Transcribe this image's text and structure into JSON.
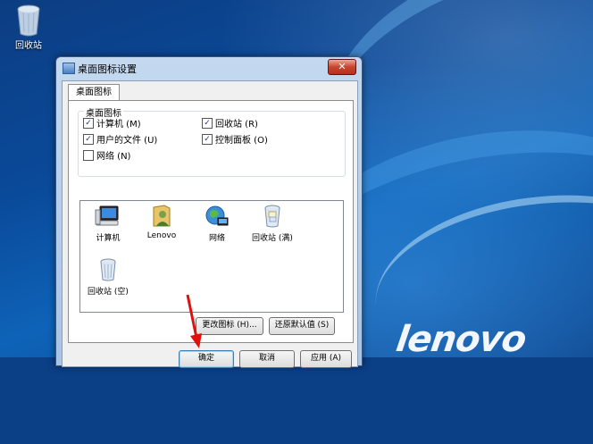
{
  "desktop": {
    "recycle_bin_label": "回收站",
    "brand_logo": "lenovo"
  },
  "dialog": {
    "title": "桌面图标设置",
    "close_glyph": "✕",
    "tab_label": "桌面图标",
    "group_label": "桌面图标",
    "checkboxes": [
      {
        "label": "计算机 (M)",
        "checked": true
      },
      {
        "label": "回收站 (R)",
        "checked": true
      },
      {
        "label": "用户的文件 (U)",
        "checked": true
      },
      {
        "label": "控制面板 (O)",
        "checked": true
      },
      {
        "label": "网络 (N)",
        "checked": false
      }
    ],
    "check_glyph": "✓",
    "icons": [
      {
        "label": "计算机",
        "icon": "computer-icon"
      },
      {
        "label": "Lenovo",
        "icon": "user-folder-icon"
      },
      {
        "label": "网络",
        "icon": "network-globe-icon"
      },
      {
        "label": "回收站 (满)",
        "icon": "recycle-bin-full-icon"
      },
      {
        "label": "回收站 (空)",
        "icon": "recycle-bin-empty-icon"
      }
    ],
    "change_icon_button": "更改图标 (H)...",
    "restore_default_button": "还原默认值 (S)",
    "ok_button": "确定",
    "cancel_button": "取消",
    "apply_button": "应用 (A)"
  },
  "colors": {
    "annotation_arrow": "#e01010",
    "close_button": "#c7452e"
  }
}
